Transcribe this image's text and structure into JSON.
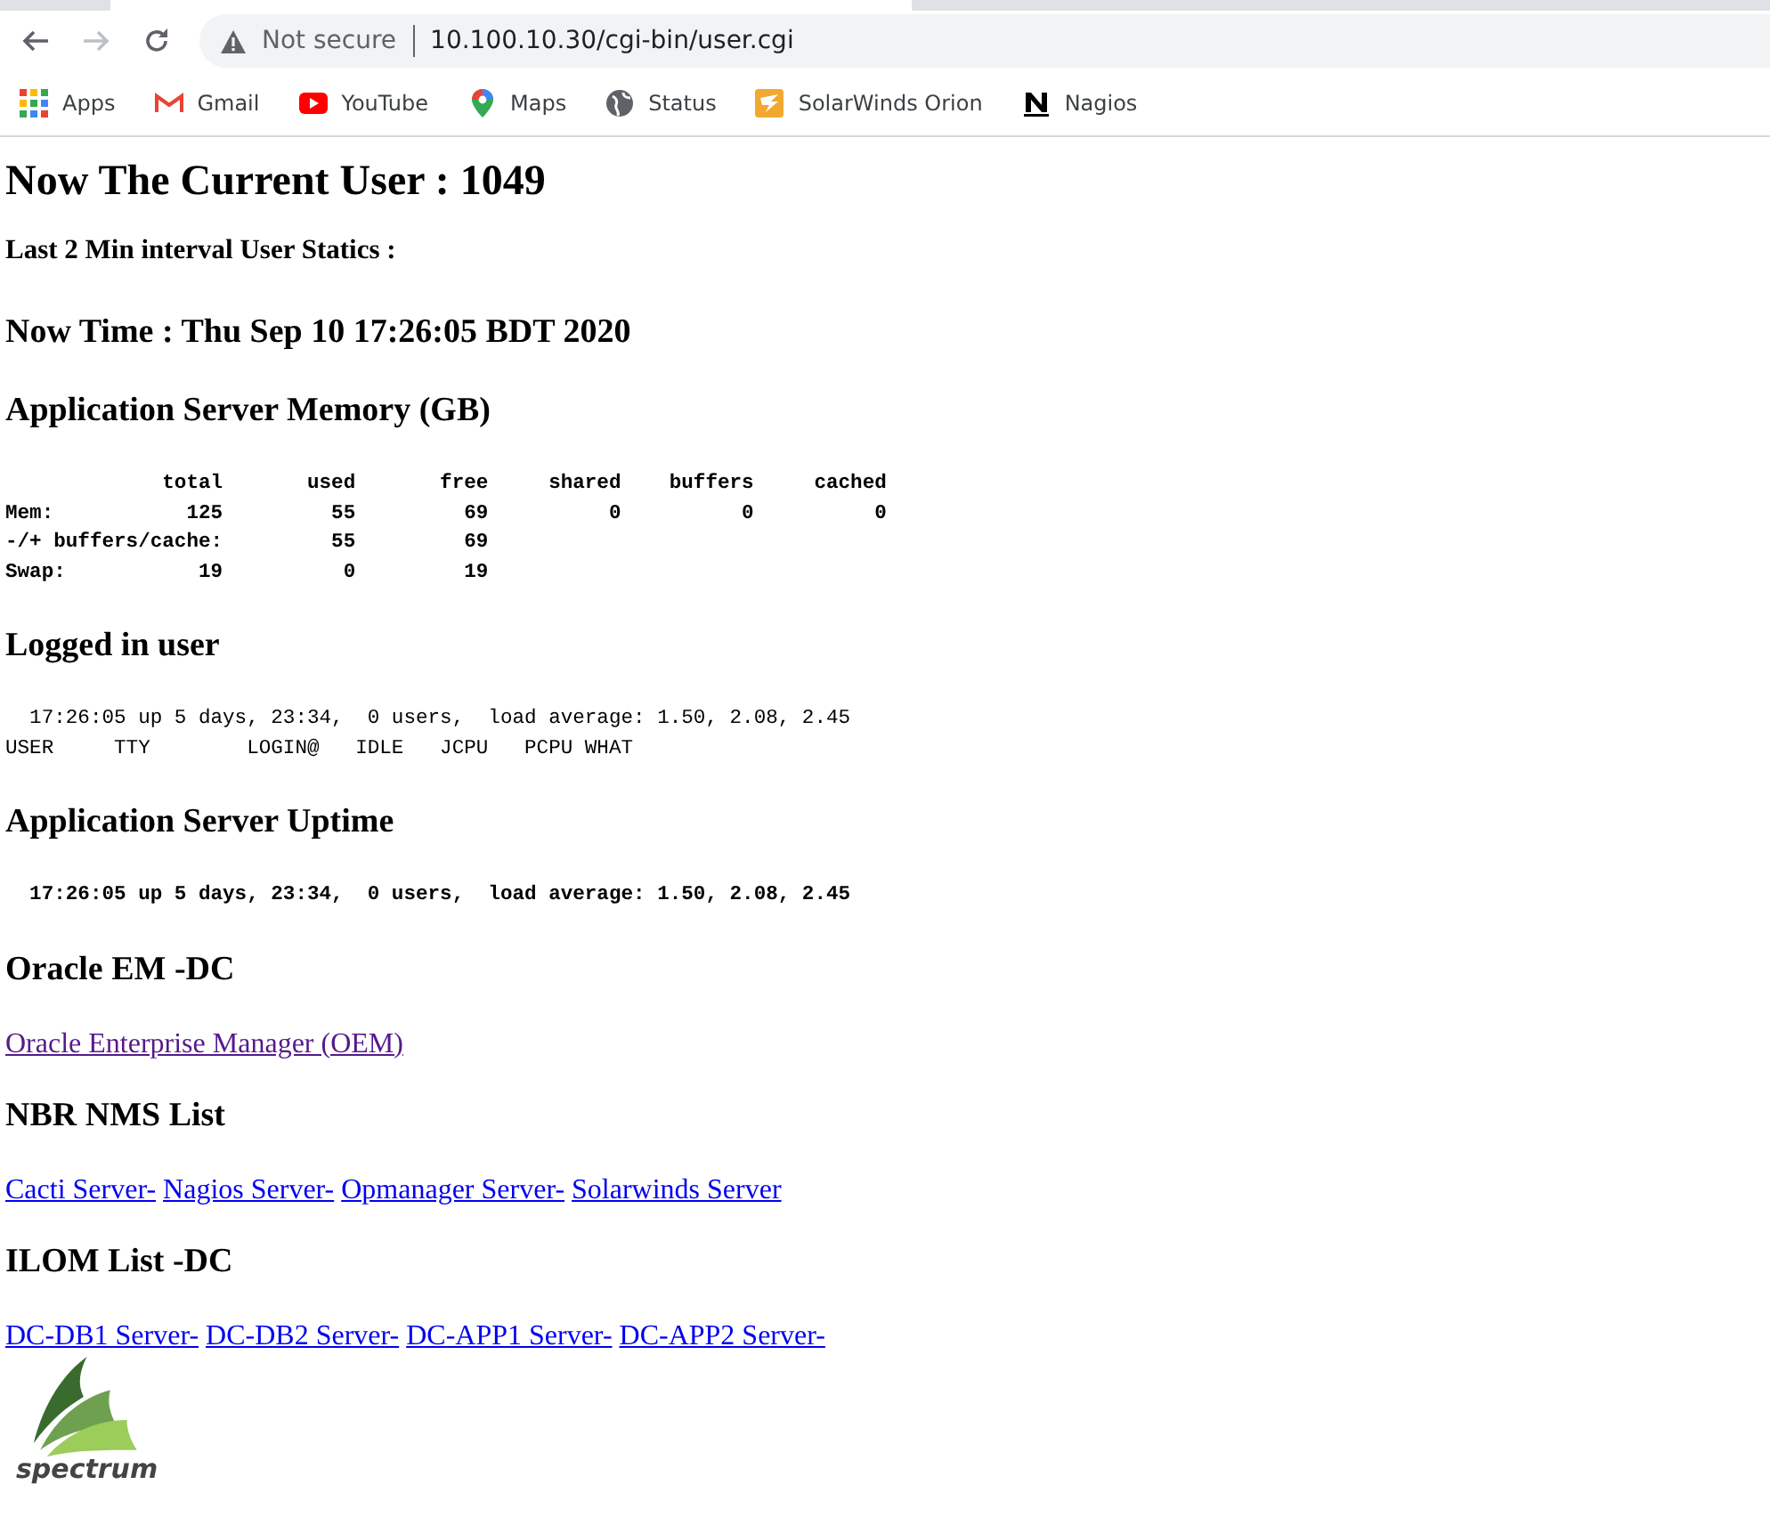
{
  "browser": {
    "security_label": "Not secure",
    "url": "10.100.10.30/cgi-bin/user.cgi",
    "bookmarks": [
      {
        "label": "Apps",
        "kind": "apps"
      },
      {
        "label": "Gmail",
        "kind": "gmail"
      },
      {
        "label": "YouTube",
        "kind": "youtube"
      },
      {
        "label": "Maps",
        "kind": "maps"
      },
      {
        "label": "Status",
        "kind": "globe"
      },
      {
        "label": "SolarWinds Orion",
        "kind": "solarwinds"
      },
      {
        "label": "Nagios",
        "kind": "nagios"
      }
    ]
  },
  "page": {
    "title": "Now The Current User : 1049",
    "interval_label": "Last 2 Min interval User Statics :",
    "now_time": "Now Time : Thu Sep 10 17:26:05 BDT 2020",
    "sections": [
      {
        "kind": "pre",
        "heading": "Application Server Memory (GB)",
        "bold": true,
        "lines": [
          "             total       used       free     shared    buffers     cached",
          "Mem:           125         55         69          0          0          0",
          "-/+ buffers/cache:         55         69",
          "Swap:           19          0         19"
        ]
      },
      {
        "kind": "pre",
        "heading": "Logged in user",
        "bold": false,
        "lines": [
          "  17:26:05 up 5 days, 23:34,  0 users,  load average: 1.50, 2.08, 2.45",
          "USER     TTY        LOGIN@   IDLE   JCPU   PCPU WHAT"
        ]
      },
      {
        "kind": "pre",
        "heading": "Application Server Uptime",
        "bold": true,
        "lines": [
          "  17:26:05 up 5 days, 23:34,  0 users,  load average: 1.50, 2.08, 2.45"
        ]
      },
      {
        "kind": "links",
        "heading": "Oracle EM -DC",
        "links": [
          {
            "label": "Oracle Enterprise Manager (OEM)",
            "visited": true
          }
        ]
      },
      {
        "kind": "links",
        "heading": "NBR NMS List",
        "links": [
          {
            "label": "Cacti Server-",
            "visited": false
          },
          {
            "label": "Nagios Server-",
            "visited": false
          },
          {
            "label": "Opmanager Server-",
            "visited": false
          },
          {
            "label": "Solarwinds Server",
            "visited": false
          }
        ]
      },
      {
        "kind": "links",
        "heading": "ILOM List -DC",
        "links": [
          {
            "label": "DC-DB1 Server-",
            "visited": false
          },
          {
            "label": "DC-DB2 Server-",
            "visited": false
          },
          {
            "label": "DC-APP1 Server-",
            "visited": false
          },
          {
            "label": "DC-APP2 Server-",
            "visited": false
          }
        ]
      }
    ],
    "logo": {
      "text": "spectrum"
    }
  }
}
